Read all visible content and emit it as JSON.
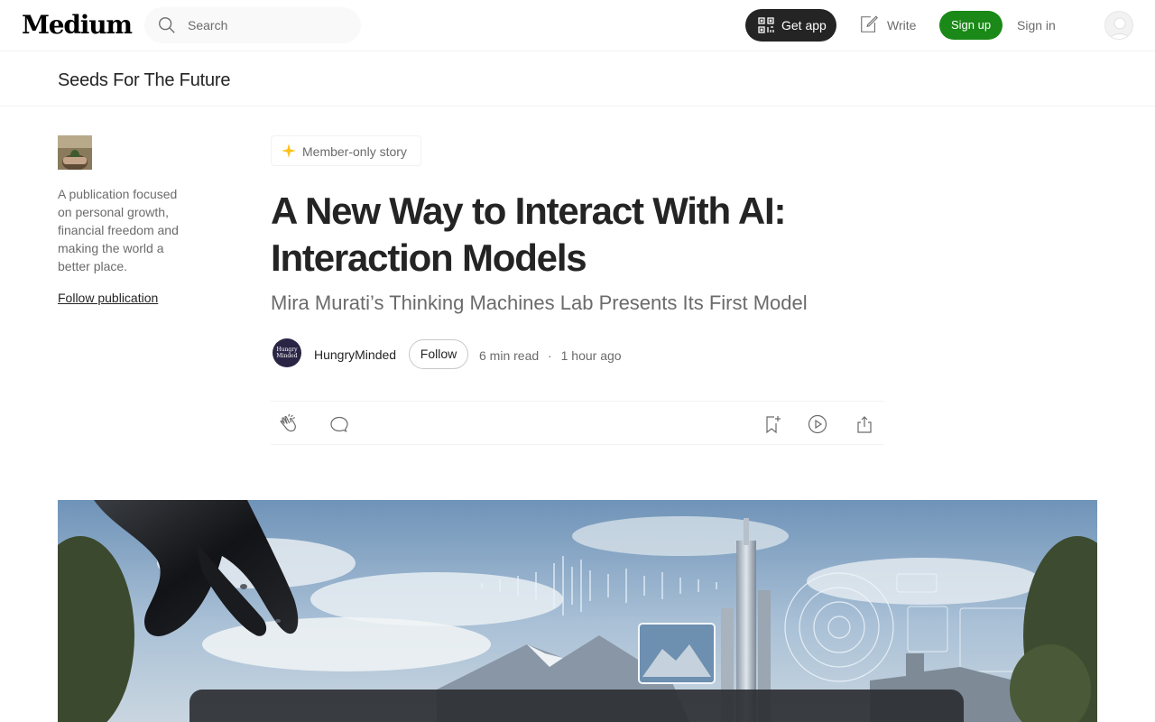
{
  "app": {
    "logo": "Medium"
  },
  "topbar": {
    "search_placeholder": "Search",
    "get_app_label": "Get app",
    "write_label": "Write",
    "signup_label": "Sign up",
    "signin_label": "Sign in"
  },
  "publication": {
    "name": "Seeds For The Future",
    "description": "A publication focused on personal growth, financial freedom and making the world a better place.",
    "follow_label": "Follow publication"
  },
  "article": {
    "badge": "Member-only story",
    "title": "A New Way to Interact With AI: Interaction Models",
    "subtitle": "Mira Murati’s Thinking Machines Lab Presents Its First Model",
    "author": "HungryMinded",
    "author_avatar_text": "Hungry Minded",
    "follow_label": "Follow",
    "read_time": "6 min read",
    "separator": "·",
    "published": "1 hour ago"
  },
  "actions": {
    "icons": [
      "clap-icon",
      "comment-icon",
      "bookmark-icon",
      "listen-icon",
      "share-icon"
    ]
  },
  "colors": {
    "accent_green": "#1a8917",
    "star_yellow": "#ffc017",
    "text_primary": "#242424",
    "text_secondary": "#6b6b6b"
  }
}
